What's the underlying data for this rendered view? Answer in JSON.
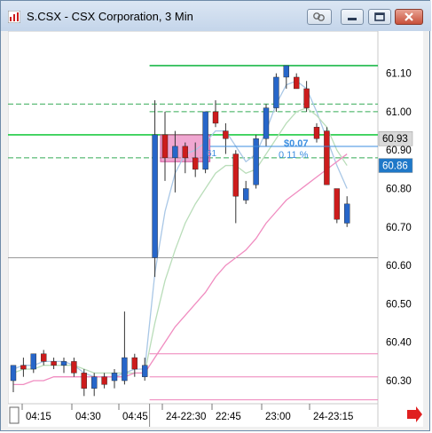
{
  "window": {
    "title": "S.CSX - CSX Corporation, 3 Min",
    "buttons": [
      "link",
      "minimize",
      "maximize",
      "close"
    ]
  },
  "chart_data": {
    "type": "candlestick",
    "symbol": "S.CSX",
    "interval": "3 Min",
    "ylim": [
      60.24,
      61.21
    ],
    "y_ticks": [
      61.1,
      61.0,
      60.9,
      60.8,
      60.7,
      60.6,
      60.5,
      60.4,
      60.3
    ],
    "y_tick_labels": [
      "61.10",
      "61.00",
      "60.90",
      "60.80",
      "60.70",
      "60.60",
      "60.50",
      "60.40",
      "60.30"
    ],
    "x_ticks": [
      "04:15",
      "04:30",
      "04:45",
      "24-22:30",
      "22:45",
      "23:00",
      "24-23:15"
    ],
    "price_badges": [
      {
        "label": "60.93",
        "value": 60.93,
        "color": "#d9d9d9",
        "text_color": "#000000"
      },
      {
        "label": "60.86",
        "value": 60.86,
        "color": "#1f78c8",
        "text_color": "#ffffff"
      }
    ],
    "annotation": {
      "change": "$0.07",
      "percent": "0.11 %",
      "marker": "61"
    },
    "session_break_index": 14,
    "candles": [
      {
        "o": 60.3,
        "h": 60.34,
        "l": 60.27,
        "c": 60.34
      },
      {
        "o": 60.34,
        "h": 60.36,
        "l": 60.31,
        "c": 60.33
      },
      {
        "o": 60.33,
        "h": 60.37,
        "l": 60.32,
        "c": 60.37
      },
      {
        "o": 60.37,
        "h": 60.38,
        "l": 60.34,
        "c": 60.35
      },
      {
        "o": 60.35,
        "h": 60.36,
        "l": 60.33,
        "c": 60.34
      },
      {
        "o": 60.34,
        "h": 60.36,
        "l": 60.32,
        "c": 60.35
      },
      {
        "o": 60.35,
        "h": 60.36,
        "l": 60.31,
        "c": 60.32
      },
      {
        "o": 60.32,
        "h": 60.33,
        "l": 60.26,
        "c": 60.28
      },
      {
        "o": 60.28,
        "h": 60.32,
        "l": 60.26,
        "c": 60.31
      },
      {
        "o": 60.31,
        "h": 60.32,
        "l": 60.28,
        "c": 60.29
      },
      {
        "o": 60.3,
        "h": 60.33,
        "l": 60.28,
        "c": 60.32
      },
      {
        "o": 60.3,
        "h": 60.48,
        "l": 60.29,
        "c": 60.36
      },
      {
        "o": 60.36,
        "h": 60.37,
        "l": 60.31,
        "c": 60.33
      },
      {
        "o": 60.31,
        "h": 60.36,
        "l": 60.3,
        "c": 60.34
      },
      {
        "o": 60.62,
        "h": 61.03,
        "l": 60.57,
        "c": 60.94
      },
      {
        "o": 60.94,
        "h": 61.0,
        "l": 60.82,
        "c": 60.88
      },
      {
        "o": 60.88,
        "h": 60.95,
        "l": 60.79,
        "c": 60.91
      },
      {
        "o": 60.91,
        "h": 60.92,
        "l": 60.84,
        "c": 60.88
      },
      {
        "o": 60.88,
        "h": 60.92,
        "l": 60.83,
        "c": 60.85
      },
      {
        "o": 60.85,
        "h": 61.0,
        "l": 60.84,
        "c": 61.0
      },
      {
        "o": 61.0,
        "h": 61.03,
        "l": 60.96,
        "c": 60.97
      },
      {
        "o": 60.95,
        "h": 60.97,
        "l": 60.89,
        "c": 60.93
      },
      {
        "o": 60.89,
        "h": 60.9,
        "l": 60.71,
        "c": 60.78
      },
      {
        "o": 60.77,
        "h": 60.82,
        "l": 60.76,
        "c": 60.8
      },
      {
        "o": 60.81,
        "h": 60.94,
        "l": 60.8,
        "c": 60.93
      },
      {
        "o": 60.93,
        "h": 61.02,
        "l": 60.91,
        "c": 61.01
      },
      {
        "o": 61.01,
        "h": 61.1,
        "l": 61.0,
        "c": 61.09
      },
      {
        "o": 61.09,
        "h": 61.12,
        "l": 61.06,
        "c": 61.12
      },
      {
        "o": 61.09,
        "h": 61.1,
        "l": 61.06,
        "c": 61.06
      },
      {
        "o": 61.06,
        "h": 61.08,
        "l": 61.0,
        "c": 61.01
      },
      {
        "o": 60.96,
        "h": 60.97,
        "l": 60.92,
        "c": 60.93
      },
      {
        "o": 60.95,
        "h": 60.96,
        "l": 60.81,
        "c": 60.81
      },
      {
        "o": 60.8,
        "h": 60.8,
        "l": 60.71,
        "c": 60.72
      },
      {
        "o": 60.71,
        "h": 60.78,
        "l": 60.7,
        "c": 60.76
      }
    ],
    "reference_lines": [
      {
        "name": "green-upper",
        "value": 61.12,
        "color": "#1bb84a",
        "style": "solid",
        "from_index": 14
      },
      {
        "name": "green-dashed-top",
        "value": 61.02,
        "color": "#33aa55",
        "style": "dashed"
      },
      {
        "name": "green-dashed-mid",
        "value": 61.0,
        "color": "#33aa55",
        "style": "dashed",
        "from_index": 14
      },
      {
        "name": "green-solid-main",
        "value": 60.94,
        "color": "#1fcc44",
        "style": "solid"
      },
      {
        "name": "green-dashed-low",
        "value": 60.88,
        "color": "#33aa55",
        "style": "dashed"
      },
      {
        "name": "gray-prev-close",
        "value": 60.62,
        "color": "#999999",
        "style": "solid"
      },
      {
        "name": "pink-upper",
        "value": 60.37,
        "color": "#ee80b8",
        "style": "solid",
        "from_index": 14
      },
      {
        "name": "pink-mid",
        "value": 60.31,
        "color": "#ee80b8",
        "style": "solid",
        "from_index": 14
      },
      {
        "name": "pink-lower",
        "value": 60.25,
        "color": "#ee80b8",
        "style": "solid",
        "from_index": 14
      }
    ],
    "moving_averages": [
      {
        "name": "ma-blue",
        "color": "#a9c7e6",
        "values": [
          60.33,
          60.34,
          60.34,
          60.35,
          60.35,
          60.35,
          60.34,
          60.32,
          60.31,
          60.31,
          60.31,
          60.32,
          60.33,
          60.33,
          60.58,
          60.74,
          60.84,
          60.89,
          60.9,
          60.92,
          60.95,
          60.95,
          60.91,
          60.87,
          60.89,
          60.95,
          61.02,
          61.07,
          61.08,
          61.06,
          61.0,
          60.93,
          60.86,
          60.8
        ]
      },
      {
        "name": "ma-green",
        "color": "#b9ddb9",
        "values": [
          60.32,
          60.33,
          60.33,
          60.34,
          60.34,
          60.34,
          60.34,
          60.33,
          60.32,
          60.32,
          60.32,
          60.32,
          60.32,
          60.32,
          60.45,
          60.56,
          60.64,
          60.71,
          60.76,
          60.8,
          60.84,
          60.86,
          60.86,
          60.84,
          60.85,
          60.89,
          60.93,
          60.97,
          61.0,
          61.01,
          60.99,
          60.96,
          60.9,
          60.86
        ]
      },
      {
        "name": "ma-pink",
        "color": "#f08cc0",
        "values": [
          60.29,
          60.29,
          60.3,
          60.3,
          60.31,
          60.31,
          60.31,
          60.31,
          60.31,
          60.31,
          60.31,
          60.31,
          60.32,
          60.32,
          60.36,
          60.4,
          60.44,
          60.47,
          60.5,
          60.53,
          60.57,
          60.6,
          60.62,
          60.64,
          60.67,
          60.71,
          60.74,
          60.77,
          60.79,
          60.81,
          60.83,
          60.85,
          60.87,
          60.89
        ]
      }
    ],
    "highlight_box": {
      "from_index": 15,
      "to_index": 19,
      "top": 60.94,
      "bottom": 60.87,
      "color": "#e878b8"
    },
    "colors": {
      "up": "#2766c9",
      "down": "#cc1c1c",
      "grid_text": "#000000",
      "arrow": "#e02020"
    }
  }
}
